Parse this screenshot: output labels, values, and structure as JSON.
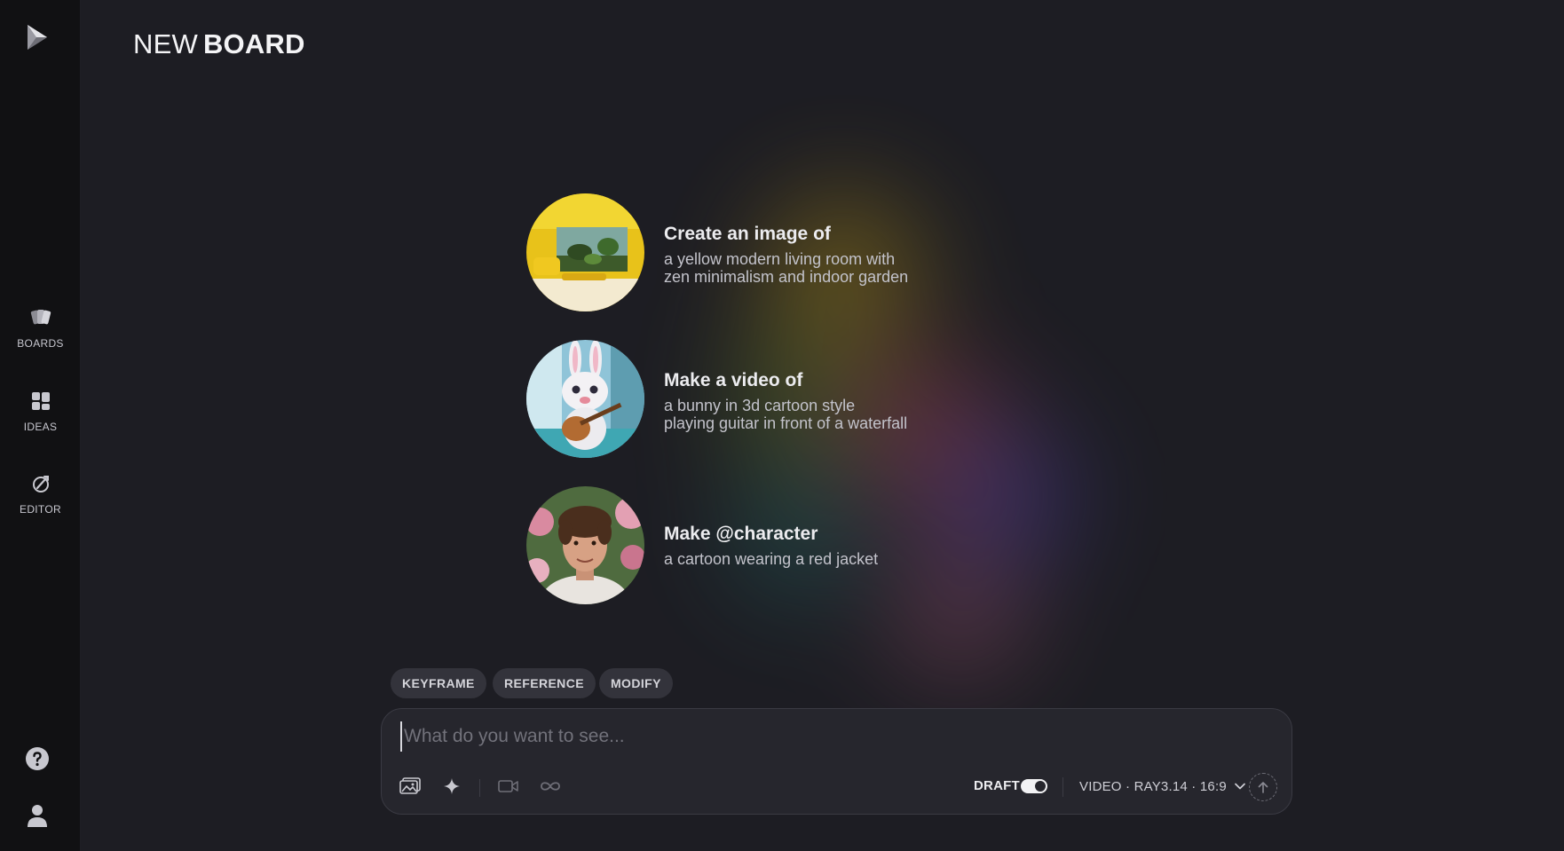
{
  "app": {
    "logo_icon": "logo-icon"
  },
  "sidebar": {
    "items": [
      {
        "label": "BOARDS",
        "icon": "boards-icon"
      },
      {
        "label": "IDEAS",
        "icon": "ideas-grid-icon"
      },
      {
        "label": "EDITOR",
        "icon": "editor-icon"
      }
    ],
    "help_icon": "help-icon",
    "account_icon": "account-icon"
  },
  "header": {
    "title_light": "NEW",
    "title_bold": "BOARD"
  },
  "suggestions": [
    {
      "title": "Create an image of",
      "line1": "a yellow modern living room with",
      "line2": "zen minimalism and indoor garden",
      "thumbnail": "living-room-thumbnail"
    },
    {
      "title": "Make a video of",
      "line1": "a bunny in 3d cartoon style",
      "line2": "playing guitar in front of a waterfall",
      "thumbnail": "bunny-thumbnail"
    },
    {
      "title": "Make @character",
      "line1": "a cartoon wearing a red jacket",
      "thumbnail": "character-portrait-thumbnail"
    }
  ],
  "modes": [
    "KEYFRAME",
    "REFERENCE",
    "MODIFY"
  ],
  "prompt": {
    "placeholder": "What do you want to see...",
    "value": "",
    "draft_label": "DRAFT",
    "draft_enabled": true,
    "model_label": "VIDEO · RAY3.14 · 16:9",
    "tools": [
      "image-upload-icon",
      "sparkle-icon",
      "video-camera-icon",
      "loop-icon"
    ],
    "submit_icon": "arrow-up-icon"
  },
  "colors": {
    "background": "#1d1d23",
    "sidebar": "#111113",
    "chip": "#33333b",
    "prompt_box": "#26262d"
  }
}
